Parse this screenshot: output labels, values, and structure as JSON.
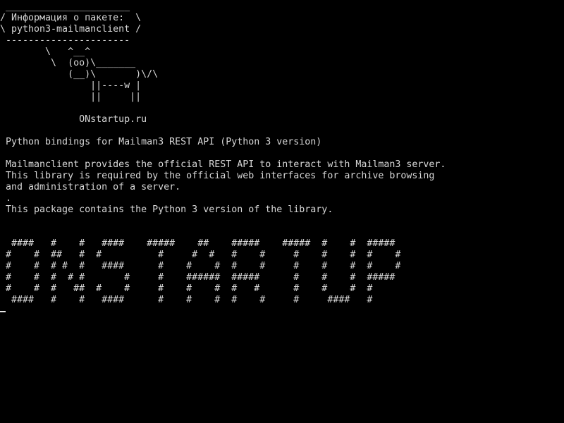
{
  "screen": {
    "foreground": "#d8d8d8",
    "background": "#000000",
    "cursor_color": "#e6e6e6"
  },
  "terminal": {
    "lines": [
      " ______________________",
      "/ Информация о пакете:  \\",
      "\\ python3-mailmanclient /",
      " ----------------------",
      "        \\   ^__^",
      "         \\  (oo)\\_______",
      "            (__)\\       )\\/\\",
      "                ||----w |",
      "                ||     ||",
      "",
      "              ONstartup.ru",
      "",
      " Python bindings for Mailman3 REST API (Python 3 version)",
      "",
      " Mailmanclient provides the official REST API to interact with Mailman3 server.",
      " This library is required by the official web interfaces for archive browsing",
      " and administration of a server.",
      " .",
      " This package contains the Python 3 version of the library.",
      "",
      "",
      "  ####   #    #   ####    #####    ##    #####    #####  #    #  #####",
      " #    #  ##   #  #          #     #  #   #    #     #    #    #  #    #",
      " #    #  # #  #   ####      #    #    #  #    #     #    #    #  #    #",
      " #    #  #  # #       #     #    ######  #####      #    #    #  #####",
      " #    #  #   ##  #    #     #    #    #  #   #      #    #    #  #",
      "  ####   #    #   ####      #    #    #  #    #     #     ####   #"
    ],
    "prompt": ""
  }
}
